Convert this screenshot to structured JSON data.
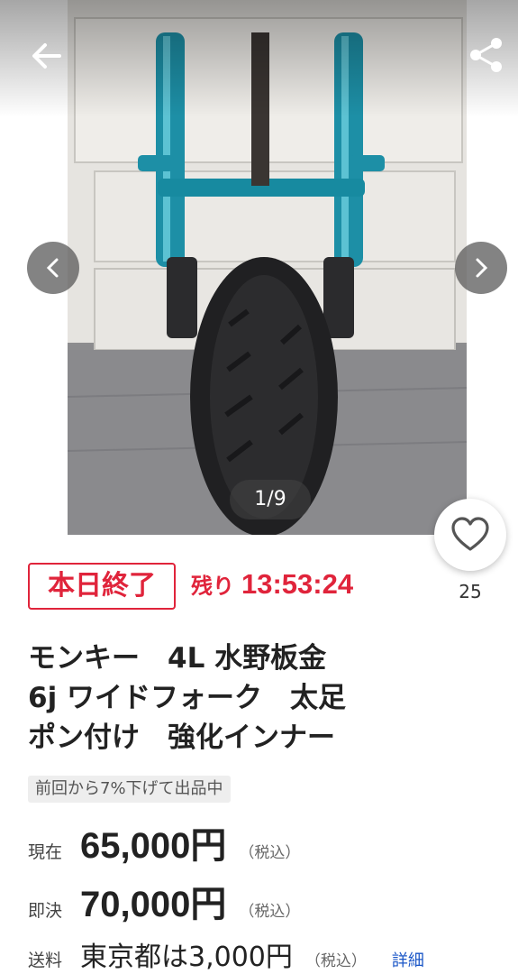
{
  "gallery": {
    "counter": "1/9",
    "favorite_count": "25",
    "icons": [
      "back-arrow-icon",
      "share-icon",
      "chevron-left-icon",
      "chevron-right-icon",
      "heart-icon"
    ]
  },
  "auction": {
    "end_badge": "本日終了",
    "remaining_label": "残り",
    "remaining_time": "13:53:24"
  },
  "item": {
    "title_line1": "モンキー　4L 水野板金",
    "title_line2": "6j ワイドフォーク　太足",
    "title_line3": "ポン付け　強化インナー",
    "price_note": "前回から7%下げて出品中"
  },
  "prices": {
    "current_label": "現在",
    "current_value": "65,000円",
    "current_tax": "（税込）",
    "buyout_label": "即決",
    "buyout_value": "70,000円",
    "buyout_tax": "（税込）",
    "shipping_label": "送料",
    "shipping_value": "東京都は3,000円",
    "shipping_tax": "（税込）",
    "shipping_detail": "詳細"
  },
  "colors": {
    "accent_red": "#e0243b",
    "link_blue": "#1a56c7"
  }
}
